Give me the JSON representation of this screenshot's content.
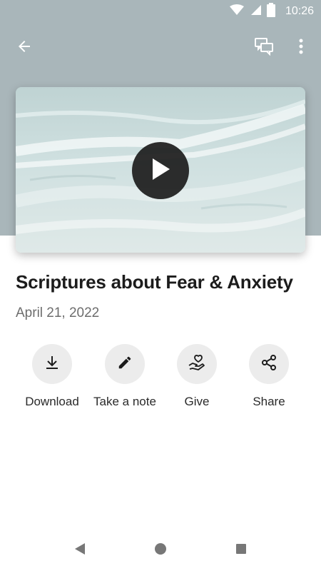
{
  "status_bar": {
    "time": "10:26"
  },
  "app_bar": {
    "back_icon": "arrow-left-icon",
    "chat_icon": "chat-bubbles-icon",
    "more_icon": "more-vert-icon"
  },
  "video": {
    "thumbnail": "ocean-waves",
    "play_icon": "play-icon"
  },
  "content": {
    "title": "Scriptures about Fear & Anxiety",
    "date": "April 21, 2022"
  },
  "actions": [
    {
      "label": "Download",
      "icon": "download-icon"
    },
    {
      "label": "Take a note",
      "icon": "pencil-icon"
    },
    {
      "label": "Give",
      "icon": "give-heart-hand-icon"
    },
    {
      "label": "Share",
      "icon": "share-icon"
    }
  ],
  "colors": {
    "header": "#a9b6ba",
    "icon_bg": "#ececec",
    "title": "#1c1c1c",
    "date": "#6d6d6d"
  }
}
